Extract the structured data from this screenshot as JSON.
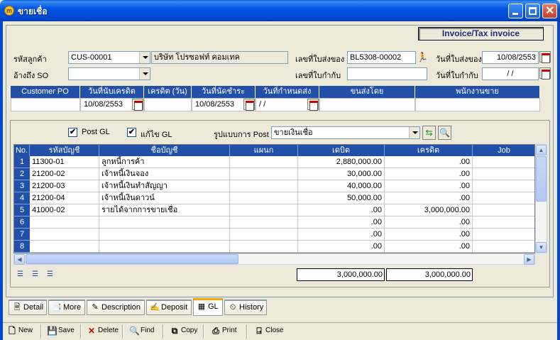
{
  "window": {
    "title": "ขายเชื่อ",
    "app_icon": "m"
  },
  "document_type": "Invoice/Tax invoice",
  "header": {
    "customer_code_label": "รหัสลูกค้า",
    "customer_code": "CUS-00001",
    "customer_name": "บริษัท โปรซอฟท์ คอมเทค",
    "ref_so_label": "อ้างถึง SO",
    "ref_so": "",
    "delivery_no_label": "เลขที่ใบส่งของ",
    "delivery_no": "BL5308-00002",
    "delivery_date_label": "วันที่ใบส่งของ",
    "delivery_date": "10/08/2553",
    "tax_no_label": "เลขที่ใบกำกับ",
    "tax_no": "",
    "tax_date_label": "วันที่ใบกำกับ",
    "tax_date": " /  / "
  },
  "po": {
    "headers": [
      "Customer PO",
      "วันที่นับเครดิต",
      "เครดิต (วัน)",
      "วันที่นัดชำระ",
      "วันที่กำหนดส่ง",
      "ขนส่งโดย",
      "พนักงานขาย"
    ],
    "values": [
      "",
      "10/08/2553",
      "",
      "10/08/2553",
      " /  / ",
      "",
      ""
    ]
  },
  "gl": {
    "post_gl_label": "Post GL",
    "post_gl_checked": "✔",
    "edit_gl_label": "แก้ไข GL",
    "edit_gl_checked": "✔",
    "format_label": "รูปแบบการ Post",
    "format_value": "ขายเงินเชื่อ",
    "columns": [
      "No.",
      "รหัสบัญชี",
      "ชื่อบัญชี",
      "แผนก",
      "เดบิต",
      "เครดิต",
      "Job"
    ],
    "rows": [
      {
        "no": "1",
        "code": "11300-01",
        "name": "ลูกหนี้การค้า",
        "dept": "",
        "debit": "2,880,000.00",
        "credit": ".00"
      },
      {
        "no": "2",
        "code": "21200-02",
        "name": "เจ้าหนี้เงินจอง",
        "dept": "",
        "debit": "30,000.00",
        "credit": ".00"
      },
      {
        "no": "3",
        "code": "21200-03",
        "name": "เจ้าหนี้เงินทำสัญญา",
        "dept": "",
        "debit": "40,000.00",
        "credit": ".00"
      },
      {
        "no": "4",
        "code": "21200-04",
        "name": "เจ้าหนี้เงินดาวน์",
        "dept": "",
        "debit": "50,000.00",
        "credit": ".00"
      },
      {
        "no": "5",
        "code": "41000-02",
        "name": "รายได้จากการขายเชื่อ",
        "dept": "",
        "debit": ".00",
        "credit": "3,000,000.00"
      },
      {
        "no": "6",
        "code": "",
        "name": "",
        "dept": "",
        "debit": ".00",
        "credit": ".00"
      },
      {
        "no": "7",
        "code": "",
        "name": "",
        "dept": "",
        "debit": ".00",
        "credit": ".00"
      },
      {
        "no": "8",
        "code": "",
        "name": "",
        "dept": "",
        "debit": ".00",
        "credit": ".00"
      }
    ],
    "total_debit": "3,000,000.00",
    "total_credit": "3,000,000.00"
  },
  "tabs": [
    {
      "label": "Detail",
      "icon": "detail-icon"
    },
    {
      "label": "More",
      "icon": "more-icon"
    },
    {
      "label": "Description",
      "icon": "description-icon"
    },
    {
      "label": "Deposit",
      "icon": "deposit-icon"
    },
    {
      "label": "GL",
      "icon": "gl-icon"
    },
    {
      "label": "History",
      "icon": "history-icon"
    }
  ],
  "toolbar": {
    "new": "New",
    "save": "Save",
    "delete": "Delete",
    "find": "Find",
    "copy": "Copy",
    "print": "Print",
    "close": "Close"
  }
}
